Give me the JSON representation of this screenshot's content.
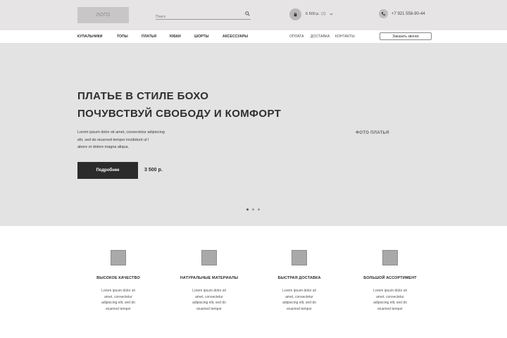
{
  "header": {
    "logo_text": "ЛОГО",
    "search_placeholder": "Поиск",
    "cart_sum": "6 500 р.",
    "cart_count": "(2)",
    "phone": "+7 921 558-90-44"
  },
  "nav": {
    "items": [
      "КУПАЛЬНИКИ",
      "ТОПЫ",
      "ПЛАТЬЯ",
      "ЮБКИ",
      "ШОРТЫ",
      "АКСЕССУАРЫ"
    ],
    "info_links": [
      "ОПЛАТА",
      "ДОСТАВКА",
      "КОНТАКТЫ"
    ],
    "callback_label": "Заказать звонок"
  },
  "hero": {
    "title_line1": "ПЛАТЬЕ В СТИЛЕ БОХО",
    "title_line2": "ПОЧУВСТВУЙ СВОБОДУ И КОМФОРТ",
    "desc_line1": "Lorem ipsum dolor sit amet, consectetur adipiscing",
    "desc_line2": "elit, sed do eiusmod tempor incididunt ut l",
    "desc_line3": "abore et dolore magna aliqua.",
    "button_label": "Подробнее",
    "price": "3 500 р.",
    "photo_label": "ФОТО ПЛАТЬЯ",
    "slides_count": 3,
    "active_slide": 1
  },
  "features": [
    {
      "title": "ВЫСОКОЕ КАЧЕСТВО",
      "text": [
        "Lorem ipsum dolor sit",
        "amet, consectetur",
        "adipiscing elit, sed do",
        "eiusmod tempor"
      ]
    },
    {
      "title": "НАТУРАЛЬНЫЕ МАТЕРИАЛЫ",
      "text": [
        "Lorem ipsum dolor sit",
        "amet, consectetur",
        "adipiscing elit, sed do",
        "eiusmod tempor"
      ]
    },
    {
      "title": "БЫСТРАЯ ДОСТАВКА",
      "text": [
        "Lorem ipsum dolor sit",
        "amet, consectetur",
        "adipiscing elit, sed do",
        "eiusmod tempor"
      ]
    },
    {
      "title": "БОЛЬШОЙ АССОРТИМЕНТ",
      "text": [
        "Lorem ipsum dolor sit",
        "amet, consectetur",
        "adipiscing elit, sed do",
        "eiusmod tempor"
      ]
    }
  ],
  "colors": {
    "header_bg": "#e6e4e4",
    "hero_bg": "#e3e3e3",
    "button_bg": "#2b2b2b",
    "placeholder_gray": "#a9a9a9"
  }
}
